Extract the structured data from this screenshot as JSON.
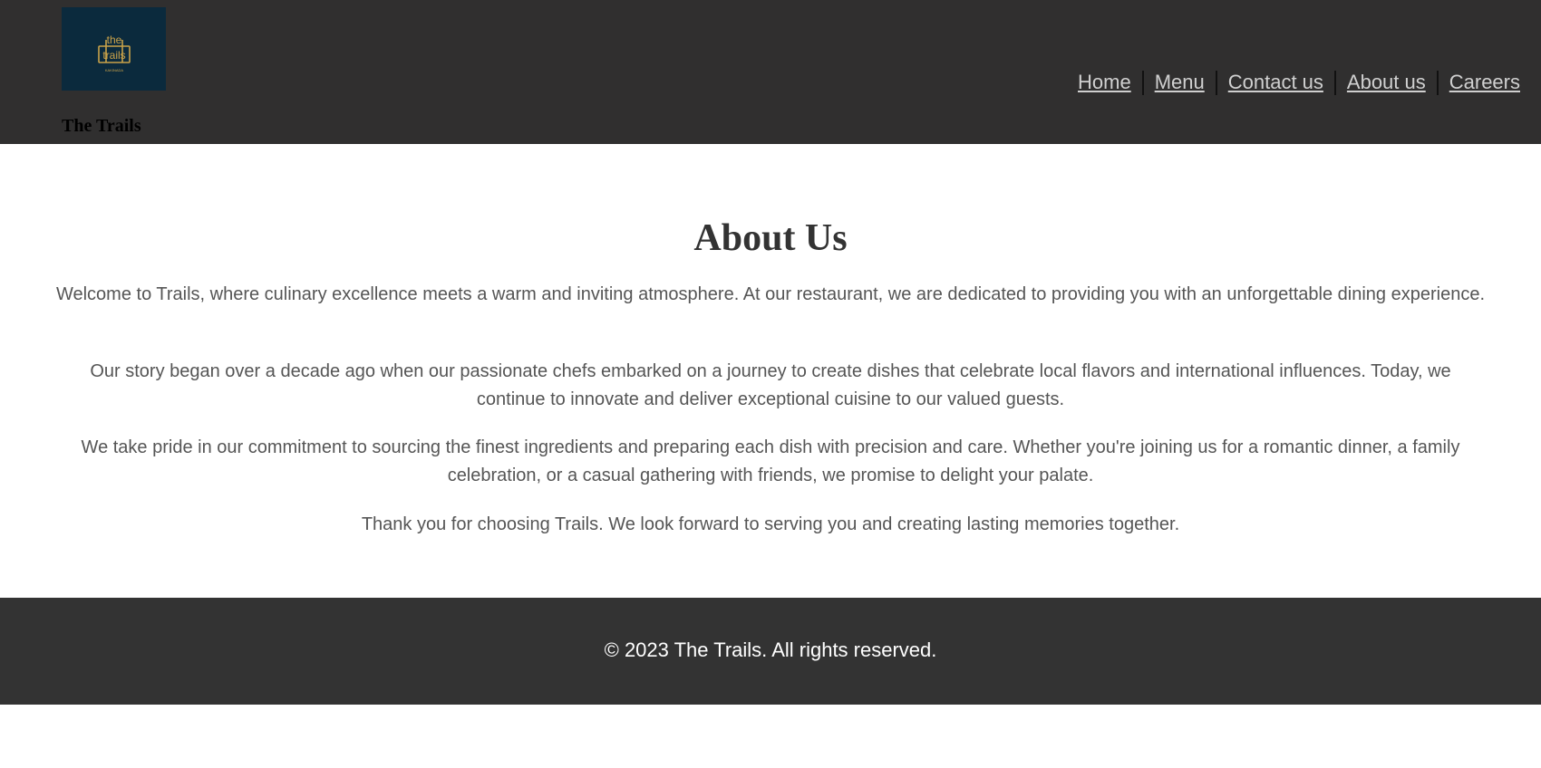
{
  "header": {
    "logo": {
      "icon": "trails-logo-icon",
      "lines": [
        "the",
        "trails"
      ],
      "tagline": "KAKINADA",
      "background": "#0b2a3d",
      "accent": "#c9a24a"
    },
    "brand_name": "The Trails",
    "nav": [
      {
        "label": "Home"
      },
      {
        "label": "Menu"
      },
      {
        "label": "Contact us"
      },
      {
        "label": "About us"
      },
      {
        "label": "Careers"
      }
    ]
  },
  "main": {
    "title": "About Us",
    "paragraphs": [
      "Welcome to Trails, where culinary excellence meets a warm and inviting atmosphere. At our restaurant, we are dedicated to providing you with an unforgettable dining experience.",
      "Our story began over a decade ago when our passionate chefs embarked on a journey to create dishes that celebrate local flavors and international influences. Today, we continue to innovate and deliver exceptional cuisine to our valued guests.",
      "We take pride in our commitment to sourcing the finest ingredients and preparing each dish with precision and care. Whether you're joining us for a romantic dinner, a family celebration, or a casual gathering with friends, we promise to delight your palate.",
      "Thank you for choosing Trails. We look forward to serving you and creating lasting memories together."
    ]
  },
  "footer": {
    "copyright": "© 2023 The Trails. All rights reserved."
  },
  "colors": {
    "header_bg": "#302f2f",
    "footer_bg": "#333333",
    "nav_link": "#d0d0d0",
    "body_text": "#555555",
    "title_text": "#333333"
  }
}
